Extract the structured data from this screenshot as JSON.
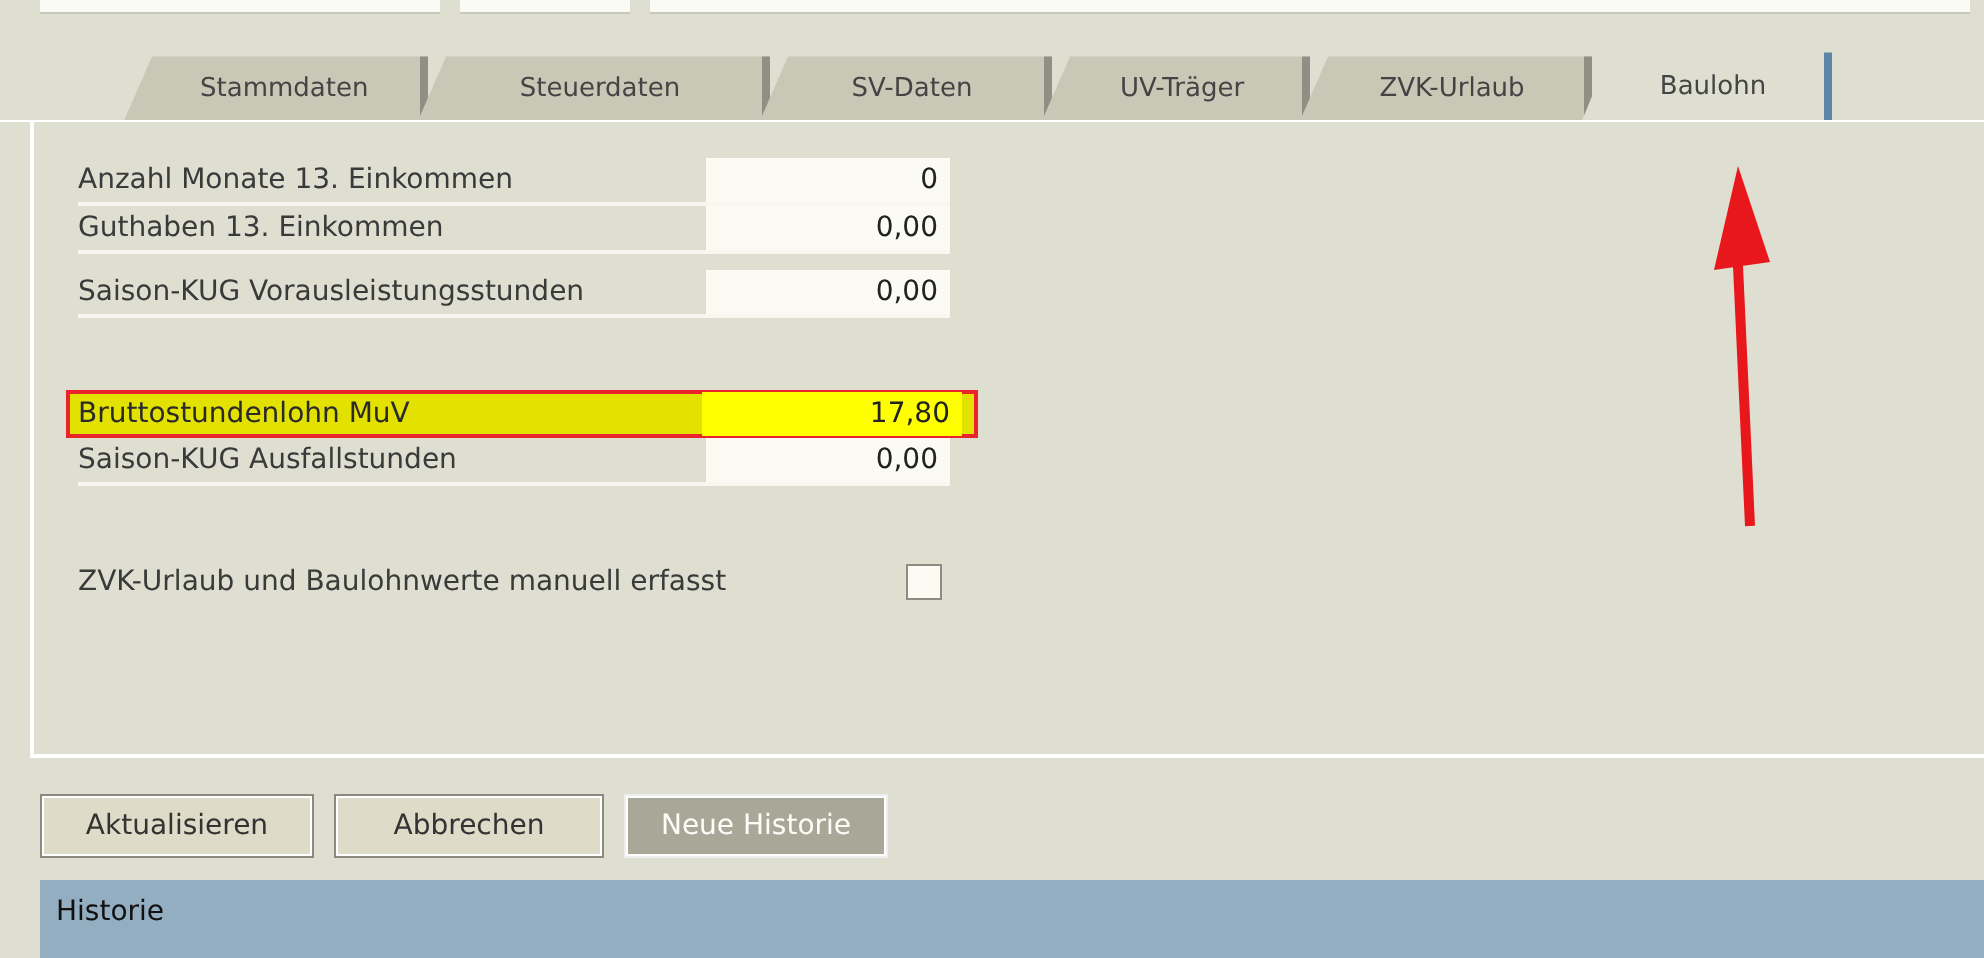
{
  "tabs": [
    {
      "label": "Stammdaten",
      "selected": false
    },
    {
      "label": "Steuerdaten",
      "selected": false
    },
    {
      "label": "SV-Daten",
      "selected": false
    },
    {
      "label": "UV-Träger",
      "selected": false
    },
    {
      "label": "ZVK-Urlaub",
      "selected": false
    },
    {
      "label": "Baulohn",
      "selected": true
    }
  ],
  "fields": [
    {
      "label": "Anzahl Monate 13. Einkommen",
      "value": "0",
      "highlighted": false
    },
    {
      "label": "Guthaben 13. Einkommen",
      "value": "0,00",
      "highlighted": false
    },
    {
      "label": "Saison-KUG Vorausleistungsstunden",
      "value": "0,00",
      "highlighted": false
    },
    {
      "label": "Bruttostundenlohn MuV",
      "value": "17,80",
      "highlighted": true
    },
    {
      "label": "Saison-KUG  Ausfallstunden",
      "value": "0,00",
      "highlighted": false
    }
  ],
  "checkbox": {
    "label": "ZVK-Urlaub und Baulohnwerte manuell erfasst",
    "checked": false
  },
  "buttons": [
    {
      "label": "Aktualisieren",
      "disabled": false
    },
    {
      "label": "Abbrechen",
      "disabled": false
    },
    {
      "label": "Neue Historie",
      "disabled": true
    }
  ],
  "history_header": "Historie"
}
